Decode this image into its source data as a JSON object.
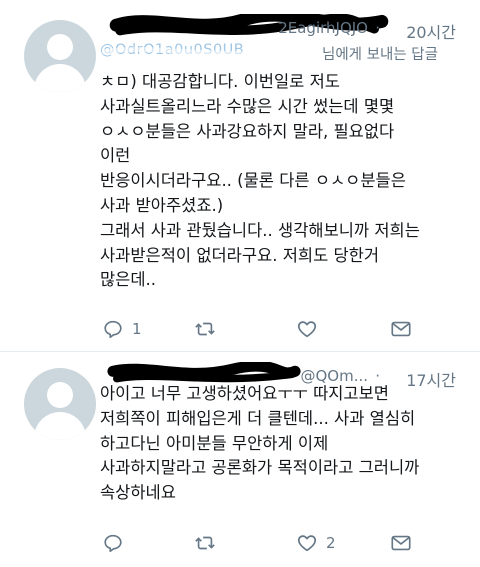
{
  "tweets": [
    {
      "handle_visible": "2EagirhJQJO",
      "time": "20시간",
      "reply_to_visible": "@OdrO1a0u0S0UB",
      "reply_suffix": "님에게 보내는 답글",
      "text": "ㅊㅁ) 대공감합니다. 이번일로 저도\n사과실트올리느라 수많은 시간 썼는데 몇몇\nㅇㅅㅇ분들은 사과강요하지 말라, 필요없다\n이런\n반응이시더라구요.. (물론 다른 ㅇㅅㅇ분들은\n사과 받아주셨죠.)\n그래서 사과 관뒀습니다.. 생각해보니까 저희는\n사과받은적이 없더라구요. 저희도 당한거\n많은데..",
      "actions": {
        "reply_count": "1",
        "retweet_count": "",
        "like_count": ""
      }
    },
    {
      "handle_visible": "@QOm...",
      "time": "17시간",
      "text": "아이고 너무 고생하셨어요ㅜㅜ 따지고보면\n저희쪽이 피해입은게 더 클텐데... 사과 열심히\n하고다닌 아미분들 무안하게 이제\n사과하지말라고 공론화가 목적이라고 그러니까\n속상하네요",
      "actions": {
        "reply_count": "",
        "retweet_count": "",
        "like_count": "2"
      }
    }
  ],
  "colors": {
    "text": "#14171a",
    "secondary": "#657786",
    "link": "#1da1f2",
    "divider": "#e6ecf0"
  },
  "icons": [
    "reply-icon",
    "retweet-icon",
    "like-icon",
    "message-icon"
  ]
}
